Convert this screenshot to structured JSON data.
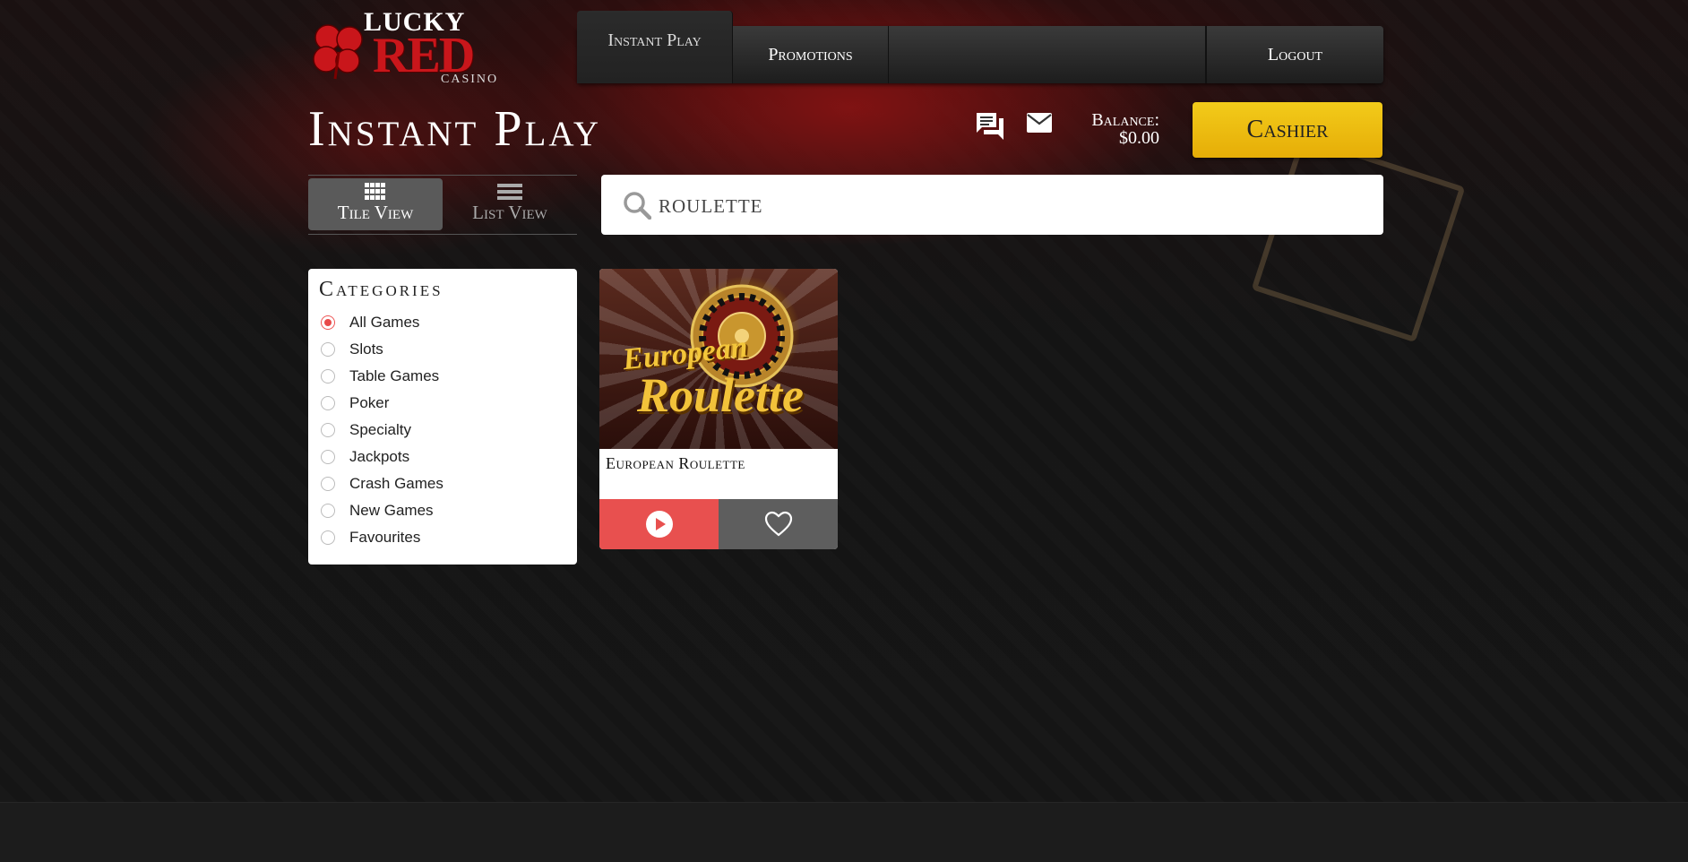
{
  "brand": {
    "logo_line1": "LUCKY",
    "logo_line2": "RED",
    "logo_line3": "CASINO",
    "red": "#c9161b",
    "gold": "#f2c21a"
  },
  "nav": {
    "items": [
      {
        "label": "Instant Play"
      },
      {
        "label": "Promotions"
      },
      {
        "label": "Logout"
      }
    ]
  },
  "header": {
    "title": "Instant Play",
    "chat_icon": "chat-icon",
    "mail_icon": "mail-icon",
    "balance_label": "Balance:",
    "balance_value": "$0.00",
    "cashier_label": "Cashier"
  },
  "view_switch": {
    "tile_label": "Tile View",
    "list_label": "List View",
    "active": "tile"
  },
  "search": {
    "value": "ROULETTE"
  },
  "categories": {
    "title": "Categories",
    "items": [
      {
        "label": "All Games",
        "selected": true
      },
      {
        "label": "Slots",
        "selected": false
      },
      {
        "label": "Table Games",
        "selected": false
      },
      {
        "label": "Poker",
        "selected": false
      },
      {
        "label": "Specialty",
        "selected": false
      },
      {
        "label": "Jackpots",
        "selected": false
      },
      {
        "label": "Crash Games",
        "selected": false
      },
      {
        "label": "New Games",
        "selected": false
      },
      {
        "label": "Favourites",
        "selected": false
      }
    ]
  },
  "games": [
    {
      "name": "European Roulette",
      "art_line1": "European",
      "art_line2": "Roulette",
      "play_icon": "play-icon",
      "favourite_icon": "heart-icon",
      "play_color": "#e8504f"
    }
  ]
}
